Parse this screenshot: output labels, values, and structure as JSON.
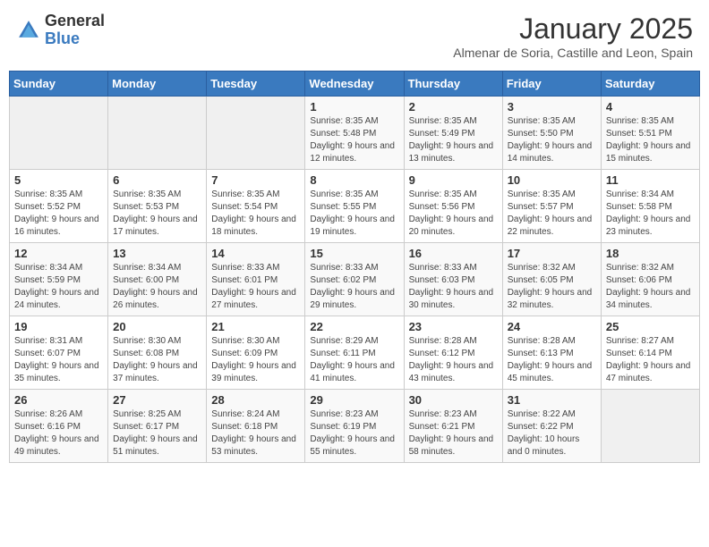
{
  "header": {
    "logo_general": "General",
    "logo_blue": "Blue",
    "month_title": "January 2025",
    "subtitle": "Almenar de Soria, Castille and Leon, Spain"
  },
  "weekdays": [
    "Sunday",
    "Monday",
    "Tuesday",
    "Wednesday",
    "Thursday",
    "Friday",
    "Saturday"
  ],
  "weeks": [
    [
      {
        "day": "",
        "sunrise": "",
        "sunset": "",
        "daylight": ""
      },
      {
        "day": "",
        "sunrise": "",
        "sunset": "",
        "daylight": ""
      },
      {
        "day": "",
        "sunrise": "",
        "sunset": "",
        "daylight": ""
      },
      {
        "day": "1",
        "sunrise": "Sunrise: 8:35 AM",
        "sunset": "Sunset: 5:48 PM",
        "daylight": "Daylight: 9 hours and 12 minutes."
      },
      {
        "day": "2",
        "sunrise": "Sunrise: 8:35 AM",
        "sunset": "Sunset: 5:49 PM",
        "daylight": "Daylight: 9 hours and 13 minutes."
      },
      {
        "day": "3",
        "sunrise": "Sunrise: 8:35 AM",
        "sunset": "Sunset: 5:50 PM",
        "daylight": "Daylight: 9 hours and 14 minutes."
      },
      {
        "day": "4",
        "sunrise": "Sunrise: 8:35 AM",
        "sunset": "Sunset: 5:51 PM",
        "daylight": "Daylight: 9 hours and 15 minutes."
      }
    ],
    [
      {
        "day": "5",
        "sunrise": "Sunrise: 8:35 AM",
        "sunset": "Sunset: 5:52 PM",
        "daylight": "Daylight: 9 hours and 16 minutes."
      },
      {
        "day": "6",
        "sunrise": "Sunrise: 8:35 AM",
        "sunset": "Sunset: 5:53 PM",
        "daylight": "Daylight: 9 hours and 17 minutes."
      },
      {
        "day": "7",
        "sunrise": "Sunrise: 8:35 AM",
        "sunset": "Sunset: 5:54 PM",
        "daylight": "Daylight: 9 hours and 18 minutes."
      },
      {
        "day": "8",
        "sunrise": "Sunrise: 8:35 AM",
        "sunset": "Sunset: 5:55 PM",
        "daylight": "Daylight: 9 hours and 19 minutes."
      },
      {
        "day": "9",
        "sunrise": "Sunrise: 8:35 AM",
        "sunset": "Sunset: 5:56 PM",
        "daylight": "Daylight: 9 hours and 20 minutes."
      },
      {
        "day": "10",
        "sunrise": "Sunrise: 8:35 AM",
        "sunset": "Sunset: 5:57 PM",
        "daylight": "Daylight: 9 hours and 22 minutes."
      },
      {
        "day": "11",
        "sunrise": "Sunrise: 8:34 AM",
        "sunset": "Sunset: 5:58 PM",
        "daylight": "Daylight: 9 hours and 23 minutes."
      }
    ],
    [
      {
        "day": "12",
        "sunrise": "Sunrise: 8:34 AM",
        "sunset": "Sunset: 5:59 PM",
        "daylight": "Daylight: 9 hours and 24 minutes."
      },
      {
        "day": "13",
        "sunrise": "Sunrise: 8:34 AM",
        "sunset": "Sunset: 6:00 PM",
        "daylight": "Daylight: 9 hours and 26 minutes."
      },
      {
        "day": "14",
        "sunrise": "Sunrise: 8:33 AM",
        "sunset": "Sunset: 6:01 PM",
        "daylight": "Daylight: 9 hours and 27 minutes."
      },
      {
        "day": "15",
        "sunrise": "Sunrise: 8:33 AM",
        "sunset": "Sunset: 6:02 PM",
        "daylight": "Daylight: 9 hours and 29 minutes."
      },
      {
        "day": "16",
        "sunrise": "Sunrise: 8:33 AM",
        "sunset": "Sunset: 6:03 PM",
        "daylight": "Daylight: 9 hours and 30 minutes."
      },
      {
        "day": "17",
        "sunrise": "Sunrise: 8:32 AM",
        "sunset": "Sunset: 6:05 PM",
        "daylight": "Daylight: 9 hours and 32 minutes."
      },
      {
        "day": "18",
        "sunrise": "Sunrise: 8:32 AM",
        "sunset": "Sunset: 6:06 PM",
        "daylight": "Daylight: 9 hours and 34 minutes."
      }
    ],
    [
      {
        "day": "19",
        "sunrise": "Sunrise: 8:31 AM",
        "sunset": "Sunset: 6:07 PM",
        "daylight": "Daylight: 9 hours and 35 minutes."
      },
      {
        "day": "20",
        "sunrise": "Sunrise: 8:30 AM",
        "sunset": "Sunset: 6:08 PM",
        "daylight": "Daylight: 9 hours and 37 minutes."
      },
      {
        "day": "21",
        "sunrise": "Sunrise: 8:30 AM",
        "sunset": "Sunset: 6:09 PM",
        "daylight": "Daylight: 9 hours and 39 minutes."
      },
      {
        "day": "22",
        "sunrise": "Sunrise: 8:29 AM",
        "sunset": "Sunset: 6:11 PM",
        "daylight": "Daylight: 9 hours and 41 minutes."
      },
      {
        "day": "23",
        "sunrise": "Sunrise: 8:28 AM",
        "sunset": "Sunset: 6:12 PM",
        "daylight": "Daylight: 9 hours and 43 minutes."
      },
      {
        "day": "24",
        "sunrise": "Sunrise: 8:28 AM",
        "sunset": "Sunset: 6:13 PM",
        "daylight": "Daylight: 9 hours and 45 minutes."
      },
      {
        "day": "25",
        "sunrise": "Sunrise: 8:27 AM",
        "sunset": "Sunset: 6:14 PM",
        "daylight": "Daylight: 9 hours and 47 minutes."
      }
    ],
    [
      {
        "day": "26",
        "sunrise": "Sunrise: 8:26 AM",
        "sunset": "Sunset: 6:16 PM",
        "daylight": "Daylight: 9 hours and 49 minutes."
      },
      {
        "day": "27",
        "sunrise": "Sunrise: 8:25 AM",
        "sunset": "Sunset: 6:17 PM",
        "daylight": "Daylight: 9 hours and 51 minutes."
      },
      {
        "day": "28",
        "sunrise": "Sunrise: 8:24 AM",
        "sunset": "Sunset: 6:18 PM",
        "daylight": "Daylight: 9 hours and 53 minutes."
      },
      {
        "day": "29",
        "sunrise": "Sunrise: 8:23 AM",
        "sunset": "Sunset: 6:19 PM",
        "daylight": "Daylight: 9 hours and 55 minutes."
      },
      {
        "day": "30",
        "sunrise": "Sunrise: 8:23 AM",
        "sunset": "Sunset: 6:21 PM",
        "daylight": "Daylight: 9 hours and 58 minutes."
      },
      {
        "day": "31",
        "sunrise": "Sunrise: 8:22 AM",
        "sunset": "Sunset: 6:22 PM",
        "daylight": "Daylight: 10 hours and 0 minutes."
      },
      {
        "day": "",
        "sunrise": "",
        "sunset": "",
        "daylight": ""
      }
    ]
  ]
}
